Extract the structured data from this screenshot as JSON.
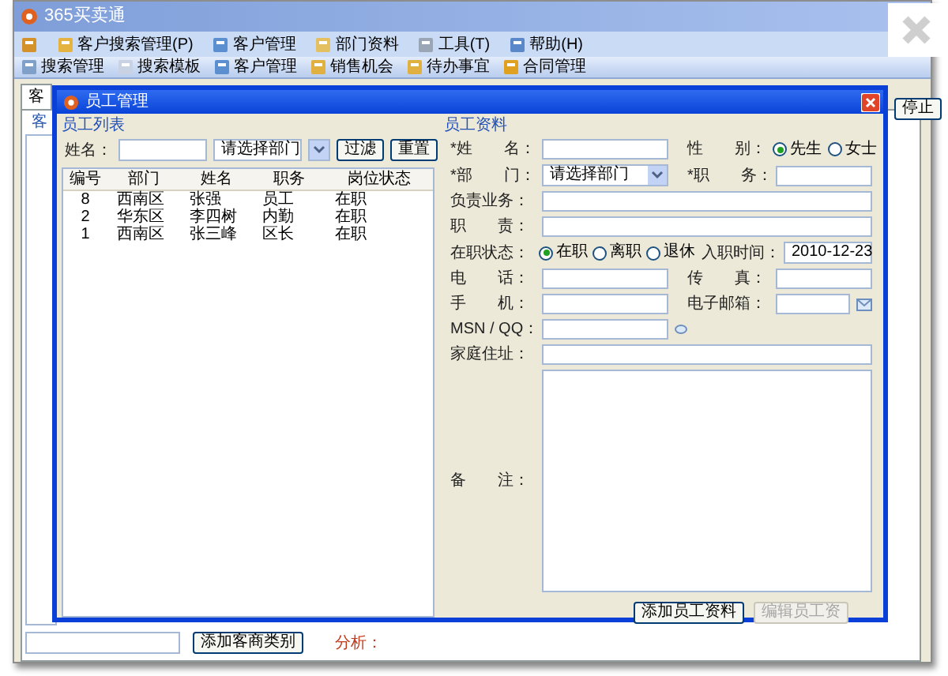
{
  "window": {
    "title": "365买卖通"
  },
  "menu": [
    {
      "label": "客户搜索管理(P)"
    },
    {
      "label": "客户管理"
    },
    {
      "label": "部门资料"
    },
    {
      "label": "工具(T)"
    },
    {
      "label": "帮助(H)"
    }
  ],
  "toolbar": [
    {
      "label": "搜索管理"
    },
    {
      "label": "搜索模板"
    },
    {
      "label": "客户管理"
    },
    {
      "label": "销售机会"
    },
    {
      "label": "待办事宜"
    },
    {
      "label": "合同管理"
    }
  ],
  "main_tabs": [
    {
      "label": "客",
      "selected": true
    }
  ],
  "sub_tabs": [
    {
      "label": "客",
      "selected": true
    }
  ],
  "stop_button": "停止",
  "bottom": {
    "add_button": "添加客商类别",
    "analysis_label": "分析："
  },
  "dialog": {
    "title": "员工管理",
    "list_panel": {
      "title": "员工列表",
      "name_label": "姓名：",
      "dept_select": "请选择部门",
      "filter_button": "过滤",
      "reset_button": "重置",
      "table": {
        "columns": [
          "编号",
          "部门",
          "姓名",
          "职务",
          "岗位状态"
        ],
        "rows": [
          [
            "8",
            "西南区",
            "张强",
            "员工",
            "在职"
          ],
          [
            "2",
            "华东区",
            "李四树",
            "内勤",
            "在职"
          ],
          [
            "1",
            "西南区",
            "张三峰",
            "区长",
            "在职"
          ]
        ]
      }
    },
    "detail_panel": {
      "title": "员工资料",
      "name_label": "*姓　　名：",
      "gender_label": "性　　别：",
      "gender_options": [
        {
          "label": "先生",
          "selected": true
        },
        {
          "label": "女士",
          "selected": false
        }
      ],
      "dept_label": "*部　　门：",
      "dept_select": "请选择部门",
      "position_label": "*职　　务：",
      "business_label": "负责业务：",
      "duty_label": "职　　责：",
      "status_label": "在职状态：",
      "status_options": [
        {
          "label": "在职",
          "selected": true
        },
        {
          "label": "离职",
          "selected": false
        },
        {
          "label": "退休",
          "selected": false
        }
      ],
      "hire_label": "入职时间：",
      "hire_date": "2010-12-23",
      "phone_label": "电　　话：",
      "fax_label": "传　　真：",
      "mobile_label": "手　　机：",
      "email_label": "电子邮箱：",
      "msn_label": "MSN / QQ：",
      "address_label": "家庭住址：",
      "notes_label": "备　　注：",
      "buttons": [
        {
          "label": "添加员工资料",
          "disabled": false
        },
        {
          "label": "编辑员工资",
          "disabled": true
        }
      ]
    }
  }
}
